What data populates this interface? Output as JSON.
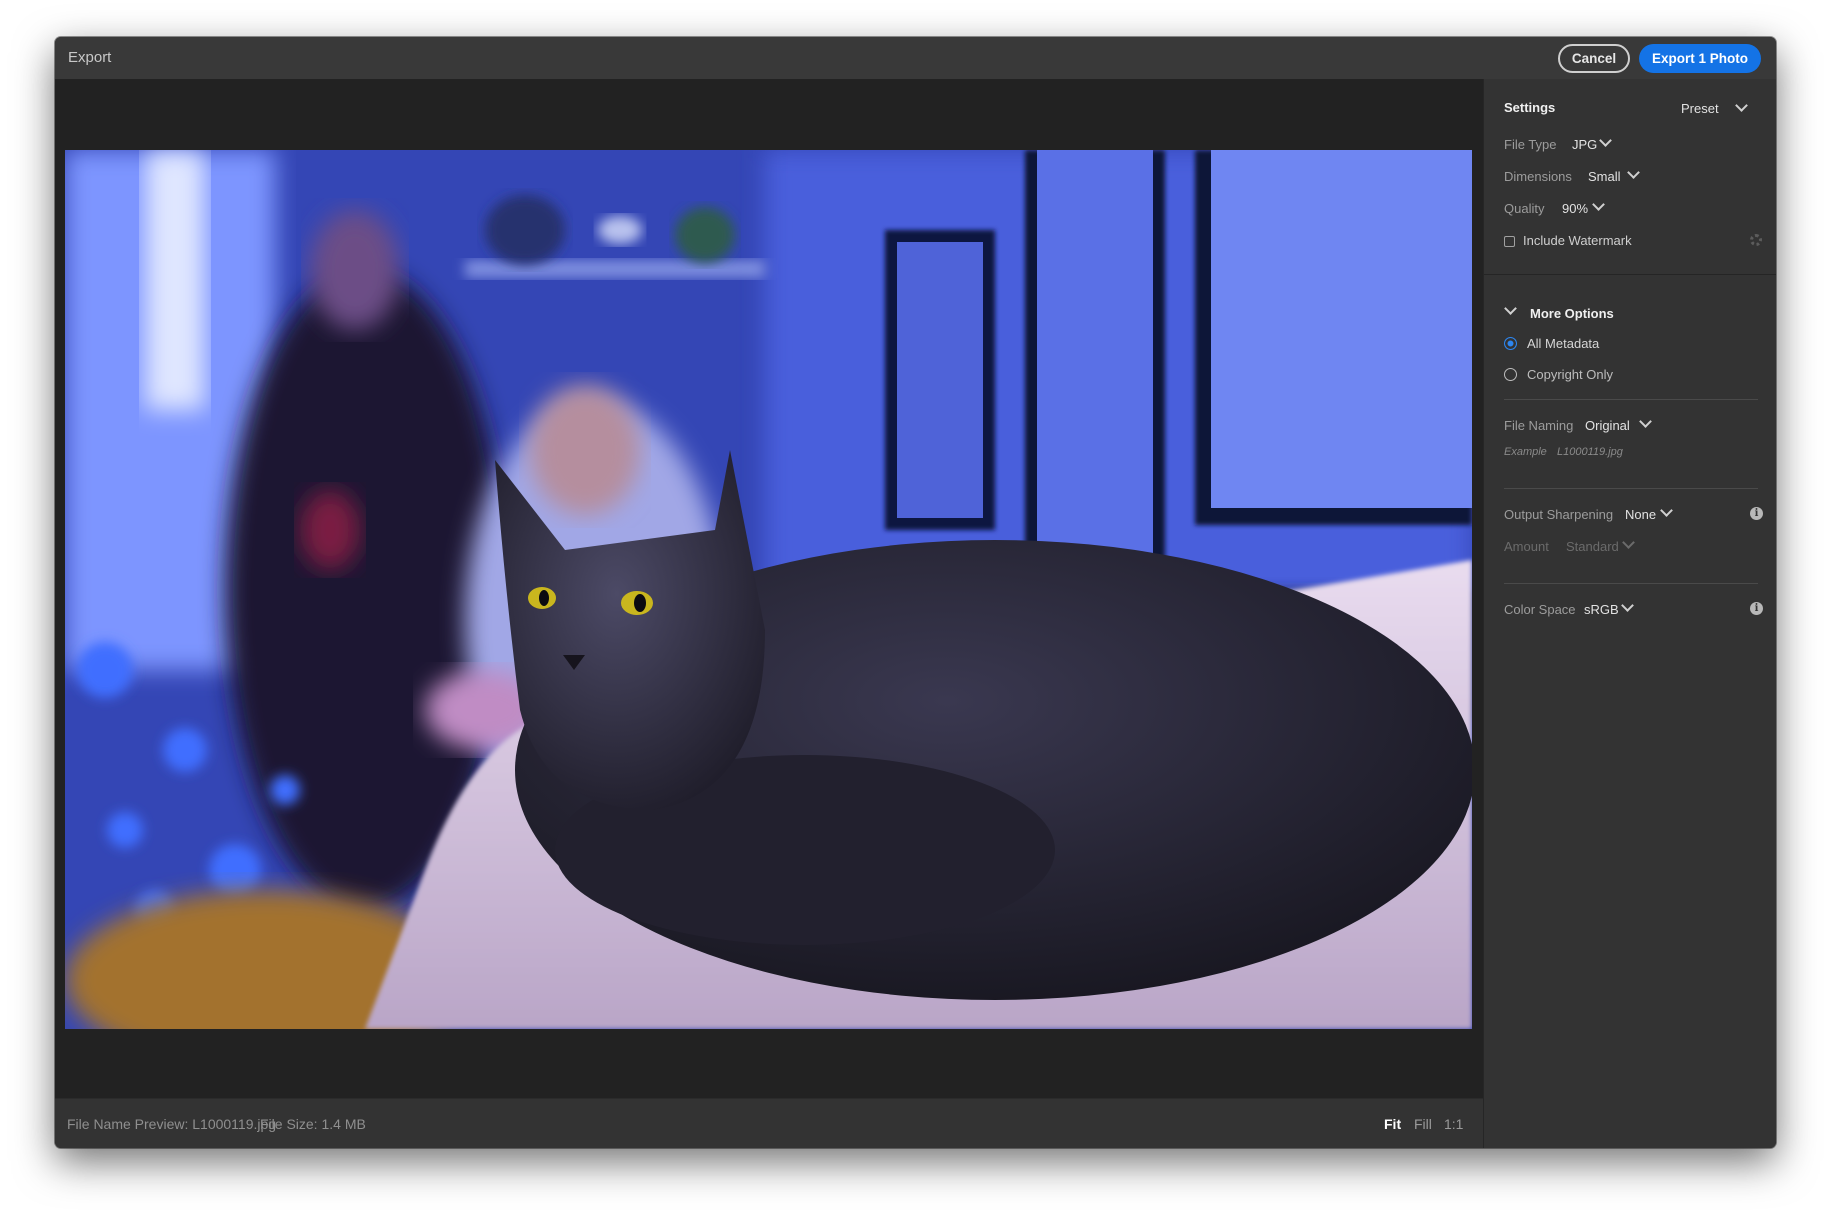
{
  "window": {
    "title": "Export",
    "cancel_label": "Cancel",
    "export_label": "Export 1 Photo"
  },
  "preview": {
    "image_description_icon": "photo-preview",
    "file_name_preview": "File Name Preview: L1000119.jpg",
    "file_size": "File Size: 1.4 MB",
    "zoom": {
      "fit": "Fit",
      "fill": "Fill",
      "one_to_one": "1:1",
      "selected": "Fit"
    }
  },
  "settings": {
    "header": "Settings",
    "preset_label": "Preset",
    "file_type": {
      "label": "File Type",
      "value": "JPG"
    },
    "dimensions": {
      "label": "Dimensions",
      "value": "Small"
    },
    "quality": {
      "label": "Quality",
      "value": "90%"
    },
    "watermark": {
      "label": "Include Watermark",
      "checked": false
    }
  },
  "more_options": {
    "header": "More Options",
    "metadata": {
      "options": [
        "All Metadata",
        "Copyright Only"
      ],
      "selected": "All Metadata"
    },
    "file_naming": {
      "label": "File Naming",
      "value": "Original",
      "example_label": "Example",
      "example_value": "L1000119.jpg"
    },
    "output_sharpening": {
      "label": "Output Sharpening",
      "value": "None",
      "amount_label": "Amount",
      "amount_value": "Standard"
    },
    "color_space": {
      "label": "Color Space",
      "value": "sRGB"
    }
  },
  "colors": {
    "accent": "#1473e6",
    "radio_on": "#2d86f0",
    "panel_bg": "#333333",
    "preview_bg": "#222222"
  }
}
